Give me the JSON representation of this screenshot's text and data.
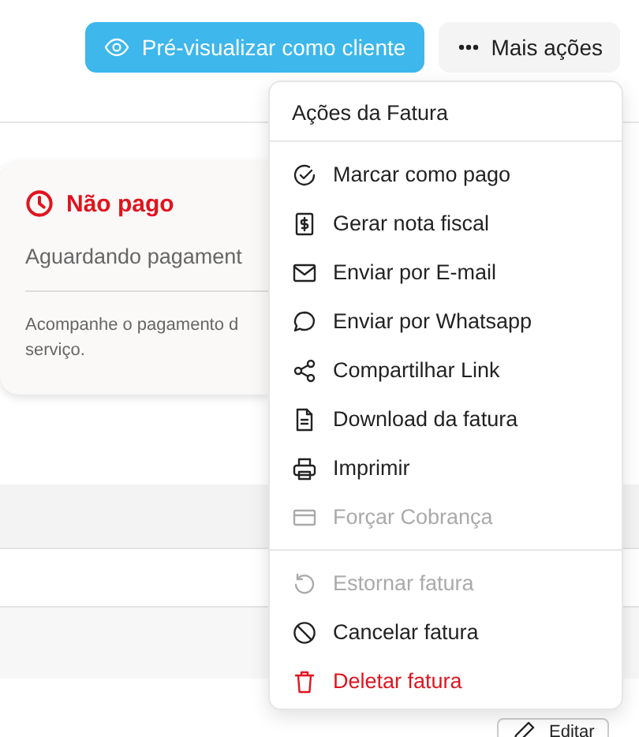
{
  "toolbar": {
    "preview_button": "Pré-visualizar como cliente",
    "more_button": "Mais ações"
  },
  "status_card": {
    "status": "Não pago",
    "subtitle": "Aguardando pagament",
    "note_lines": [
      "Acompanhe o pagamento d",
      "serviço."
    ]
  },
  "edit_button": "Editar",
  "menu": {
    "title": "Ações da Fatura",
    "sections": [
      {
        "items": [
          {
            "label": "Marcar como pago",
            "kind": "normal",
            "disabled": false
          },
          {
            "label": "Gerar nota fiscal",
            "kind": "normal",
            "disabled": false
          },
          {
            "label": "Enviar por E-mail",
            "kind": "normal",
            "disabled": false
          },
          {
            "label": "Enviar por Whatsapp",
            "kind": "normal",
            "disabled": false
          },
          {
            "label": "Compartilhar Link",
            "kind": "normal",
            "disabled": false
          },
          {
            "label": "Download da fatura",
            "kind": "normal",
            "disabled": false
          },
          {
            "label": "Imprimir",
            "kind": "normal",
            "disabled": false
          },
          {
            "label": "Forçar Cobrança",
            "kind": "normal",
            "disabled": true
          }
        ]
      },
      {
        "items": [
          {
            "label": "Estornar fatura",
            "kind": "normal",
            "disabled": true
          },
          {
            "label": "Cancelar fatura",
            "kind": "normal",
            "disabled": false
          },
          {
            "label": "Deletar fatura",
            "kind": "danger",
            "disabled": false
          }
        ]
      }
    ]
  }
}
